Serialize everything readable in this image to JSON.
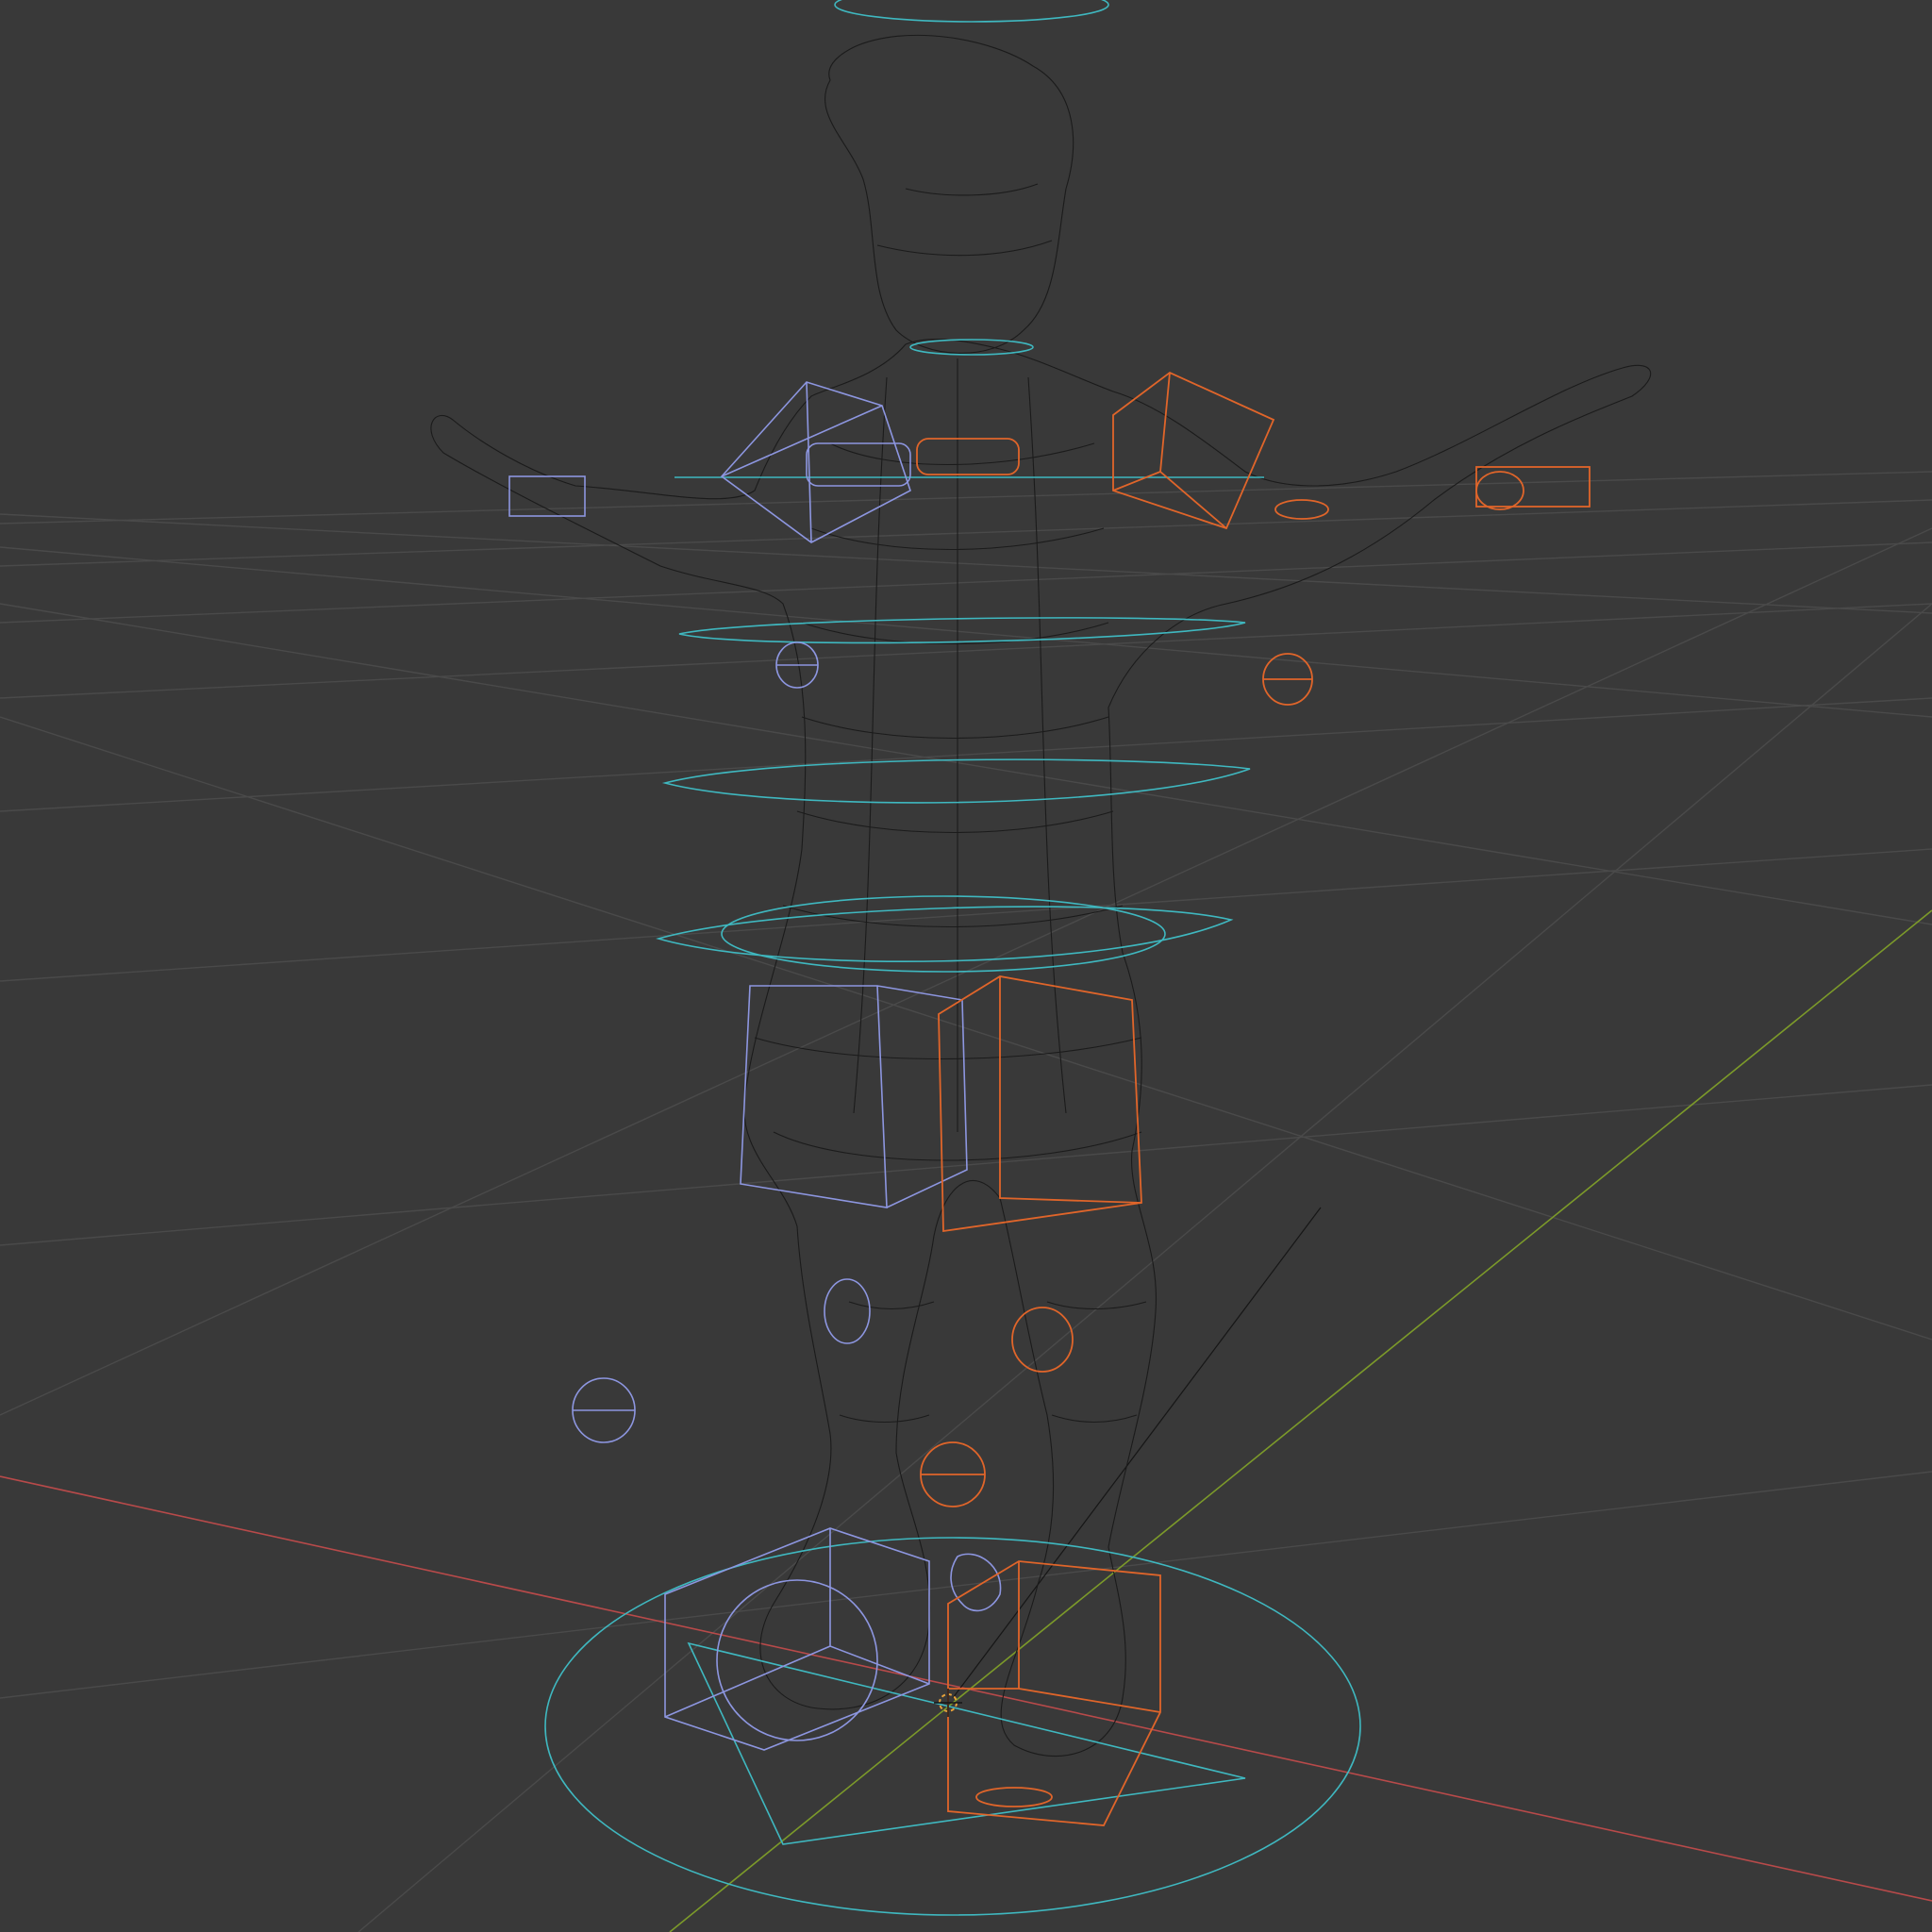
{
  "app": {
    "name": "3D Viewport",
    "shading_mode": "wireframe"
  },
  "colors": {
    "background": "#393939",
    "grid": "#4a4a4a",
    "x_axis": "#b84a4a",
    "y_axis": "#7c9a2a",
    "mesh_wire": "#1b1b1b",
    "control_cyan": "#3fb8c0",
    "control_left": "#8d96e0",
    "control_right": "#e0652a",
    "cursor_3d": "#e8a23a"
  },
  "icons": {
    "cursor": "3d-cursor-icon"
  },
  "scene": {
    "object_type": "rigged character mesh",
    "rig_controls_visible": true,
    "floor_grid_visible": true
  }
}
